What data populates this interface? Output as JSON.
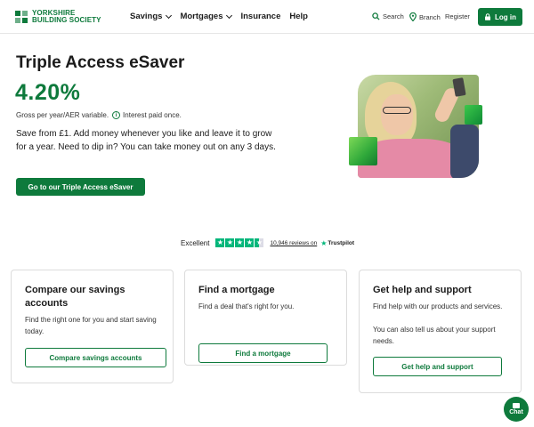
{
  "brand": {
    "name_line1": "YORKSHIRE",
    "name_line2": "BUILDING SOCIETY",
    "accent": "#0e7a3c"
  },
  "nav": {
    "items": [
      {
        "label": "Savings",
        "has_dropdown": true
      },
      {
        "label": "Mortgages",
        "has_dropdown": true
      },
      {
        "label": "Insurance",
        "has_dropdown": false
      },
      {
        "label": "Help",
        "has_dropdown": false
      }
    ],
    "search_label": "Search",
    "branch_label": "Branch",
    "register_label": "Register",
    "login_label": "Log in"
  },
  "hero": {
    "title": "Triple Access eSaver",
    "rate": "4.20%",
    "aer_text": "Gross per year/AER variable.",
    "interest_text": "Interest paid once.",
    "description": "Save from £1. Add money whenever you like and leave it to grow for a year. Need to dip in? You can take money out on any 3 days.",
    "cta_label": "Go to our Triple Access eSaver"
  },
  "trustpilot": {
    "rating_word": "Excellent",
    "reviews_text": "10,946 reviews on",
    "brand": "Trustpilot",
    "stars": 4.5,
    "star_color": "#00b67a"
  },
  "cards": [
    {
      "title": "Compare our savings accounts",
      "body": "Find the right one for you and start saving today.",
      "button": "Compare savings accounts"
    },
    {
      "title": "Find a mortgage",
      "body": "Find a deal that's right for you.",
      "button": "Find a mortgage"
    },
    {
      "title": "Get help and support",
      "body": "Find help with our products and services.",
      "body2": "You can also tell us about your support needs.",
      "button": "Get help and support"
    }
  ],
  "chat": {
    "label": "Chat"
  }
}
